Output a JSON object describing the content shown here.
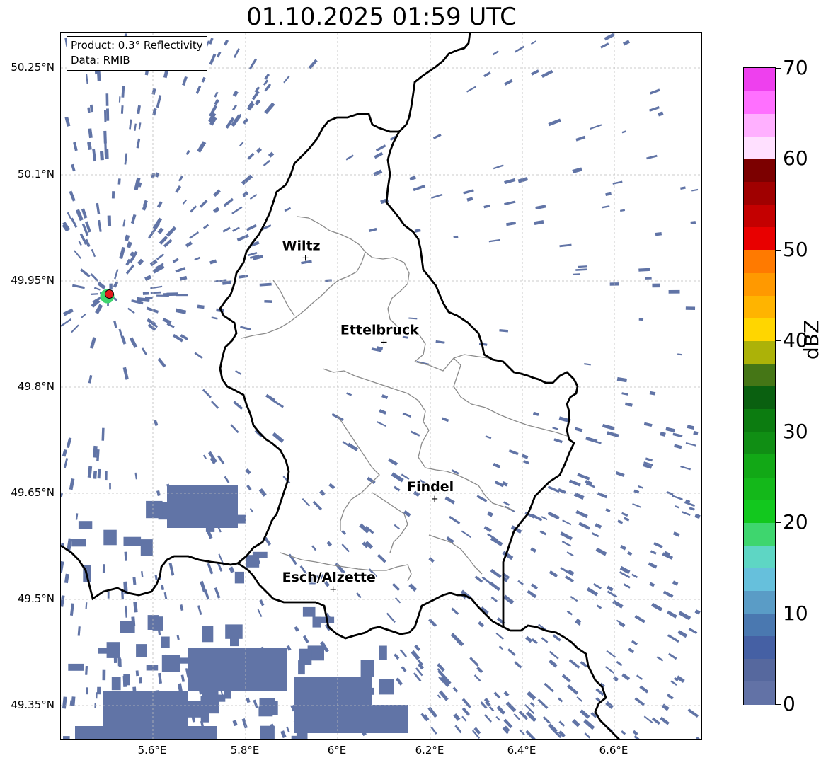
{
  "title": "01.10.2025 01:59 UTC",
  "info_box": {
    "product": "Product: 0.3° Reflectivity",
    "data": "Data: RMIB"
  },
  "lat_labels": [
    "50.25°N",
    "50.1°N",
    "49.95°N",
    "49.8°N",
    "49.65°N",
    "49.5°N",
    "49.35°N"
  ],
  "lon_labels": [
    "5.6°E",
    "5.8°E",
    "6°E",
    "6.2°E",
    "6.4°E",
    "6.6°E"
  ],
  "cities": [
    {
      "name": "Wiltz",
      "lon": 5.93,
      "lat": 49.966
    },
    {
      "name": "Ettelbruck",
      "lon": 6.1,
      "lat": 49.847
    },
    {
      "name": "Findel",
      "lon": 6.21,
      "lat": 49.626
    },
    {
      "name": "Esch/Alzette",
      "lon": 5.99,
      "lat": 49.498
    }
  ],
  "radar_site": {
    "lon": 5.505,
    "lat": 49.914,
    "color": "#e31a1c"
  },
  "colorbar": {
    "unit": "dBZ",
    "min": 0,
    "max": 70,
    "ticks": [
      "0",
      "10",
      "20",
      "30",
      "40",
      "50",
      "60",
      "70"
    ],
    "colors": [
      "#6272a6",
      "#56689e",
      "#4560a4",
      "#4a78b0",
      "#5a9cc6",
      "#66c0dc",
      "#5ed6c4",
      "#3ed66e",
      "#12c81e",
      "#14b81a",
      "#12a816",
      "#108e14",
      "#0c7c10",
      "#0a6010",
      "#457616",
      "#acb208",
      "#ffd600",
      "#ffb400",
      "#ff9900",
      "#ff7a00",
      "#e80000",
      "#c40000",
      "#a00000",
      "#7c0000",
      "#ffe0ff",
      "#ffb0ff",
      "#ff70ff",
      "#ee40ee"
    ]
  },
  "echo_color": "#6174a6",
  "grid_color": "#bbbbbb"
}
